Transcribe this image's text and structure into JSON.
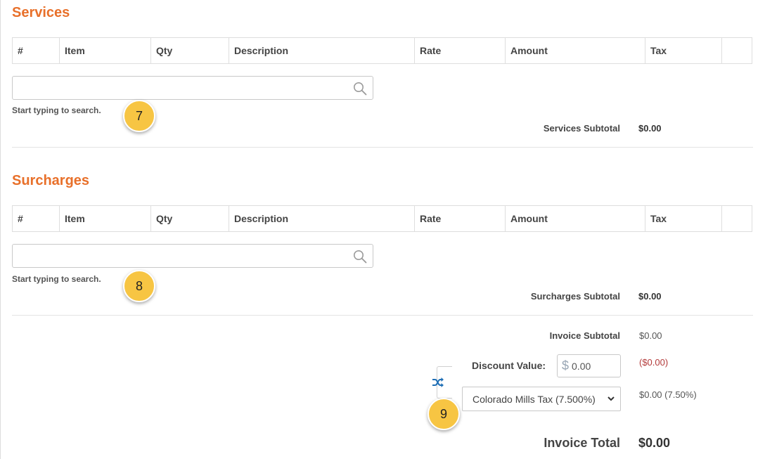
{
  "services": {
    "title": "Services",
    "columns": [
      "#",
      "Item",
      "Qty",
      "Description",
      "Rate",
      "Amount",
      "Tax",
      ""
    ],
    "search_placeholder": "",
    "hint": "Start typing to search.",
    "badge": "7",
    "subtotal_label": "Services Subtotal",
    "subtotal_value": "$0.00"
  },
  "surcharges": {
    "title": "Surcharges",
    "columns": [
      "#",
      "Item",
      "Qty",
      "Description",
      "Rate",
      "Amount",
      "Tax",
      ""
    ],
    "search_placeholder": "",
    "hint": "Start typing to search.",
    "badge": "8",
    "subtotal_label": "Surcharges Subtotal",
    "subtotal_value": "$0.00"
  },
  "totals": {
    "invoice_subtotal_label": "Invoice Subtotal",
    "invoice_subtotal_value": "$0.00",
    "discount_label": "Discount Value:",
    "discount_currency": "$",
    "discount_input_value": "0.00",
    "discount_amount": "($0.00)",
    "tax_selected": "Colorado Mills Tax (7.500%)",
    "tax_amount": "$0.00 (7.50%)",
    "badge": "9",
    "invoice_total_label": "Invoice Total",
    "invoice_total_value": "$0.00"
  },
  "colors": {
    "accent": "#e8702a",
    "badge": "#f7c543",
    "negative": "#b33a3a",
    "icon_blue": "#1f6fb5"
  }
}
